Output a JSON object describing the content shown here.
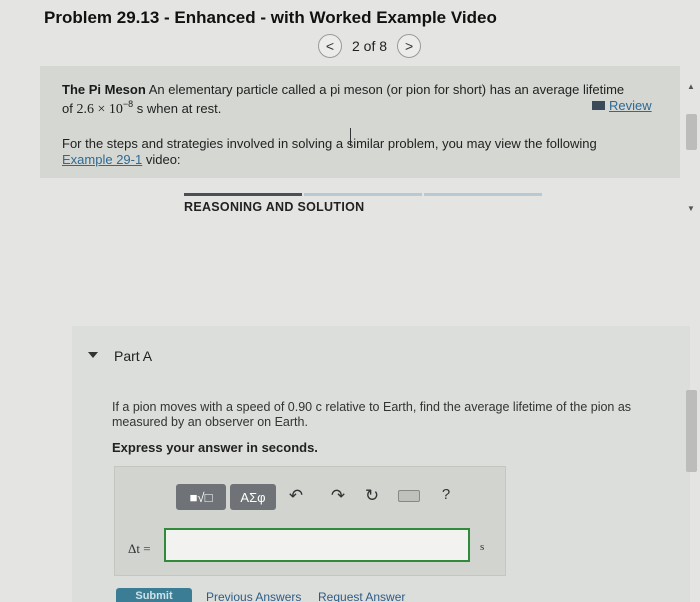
{
  "header": {
    "title": "Problem 29.13 - Enhanced - with Worked Example Video",
    "pager": {
      "prev": "<",
      "position": "2 of 8",
      "next": ">"
    }
  },
  "intro": {
    "heading": "The Pi Meson",
    "sentence": "An elementary particle called a pi meson (or pion for short) has an average lifetime",
    "prefix": "of",
    "mantissa": "2.6 × 10",
    "exponent": "−8",
    "suffix": "s when at rest.",
    "review_label": "Review",
    "steps_text": "For the steps and strategies involved in solving a similar problem, you may view the following",
    "example_link": "Example 29-1",
    "example_suffix": "video:"
  },
  "section": {
    "label": "REASONING AND SOLUTION"
  },
  "part_a": {
    "label": "Part A",
    "question": "If a pion moves with a speed of 0.90 c relative to Earth, find the average lifetime of the pion as measured by an observer on Earth.",
    "instruction": "Express your answer in seconds.",
    "toolbar": {
      "template_label": "■√□",
      "greek_label": "ΑΣφ",
      "undo_icon": "undo-icon",
      "redo_icon": "redo-icon",
      "reset_icon": "reset-icon",
      "keyboard_icon": "keyboard-icon",
      "help_label": "?"
    },
    "answer_label": "Δt =",
    "answer_value": "",
    "unit": "s"
  },
  "footer": {
    "submit_label": "Submit",
    "previous_answers": "Previous Answers",
    "request_answer": "Request Answer"
  },
  "colors": {
    "background": "#e4e4e2",
    "link": "#2e6a93",
    "input_border": "#2f8a3a",
    "submit": "#3a7d94",
    "toolbar_button": "#6f7377"
  }
}
